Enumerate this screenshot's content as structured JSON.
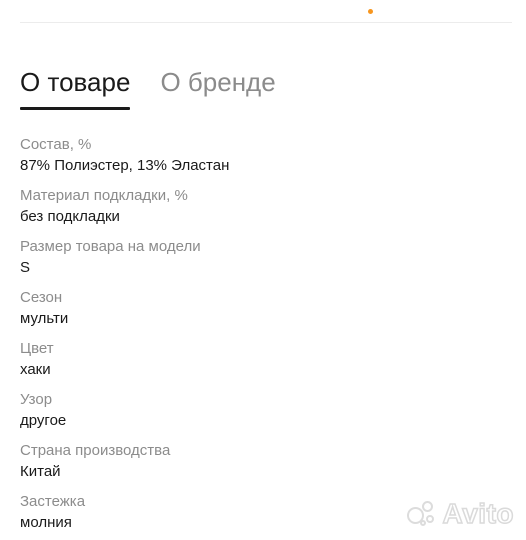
{
  "tabs": [
    {
      "label": "О товаре",
      "active": true
    },
    {
      "label": "О бренде",
      "active": false
    }
  ],
  "params": [
    {
      "label": "Состав, %",
      "value": "87% Полиэстер, 13% Эластан"
    },
    {
      "label": "Материал подкладки, %",
      "value": "без подкладки"
    },
    {
      "label": "Размер товара на модели",
      "value": "S"
    },
    {
      "label": "Сезон",
      "value": "мульти"
    },
    {
      "label": "Цвет",
      "value": "хаки"
    },
    {
      "label": "Узор",
      "value": "другое"
    },
    {
      "label": "Страна производства",
      "value": "Китай"
    },
    {
      "label": "Застежка",
      "value": "молния"
    }
  ],
  "watermark": {
    "text": "Avito"
  },
  "colors": {
    "accent": "#f7961e",
    "text": "#1a1a1a",
    "muted": "#8c8c8c"
  }
}
